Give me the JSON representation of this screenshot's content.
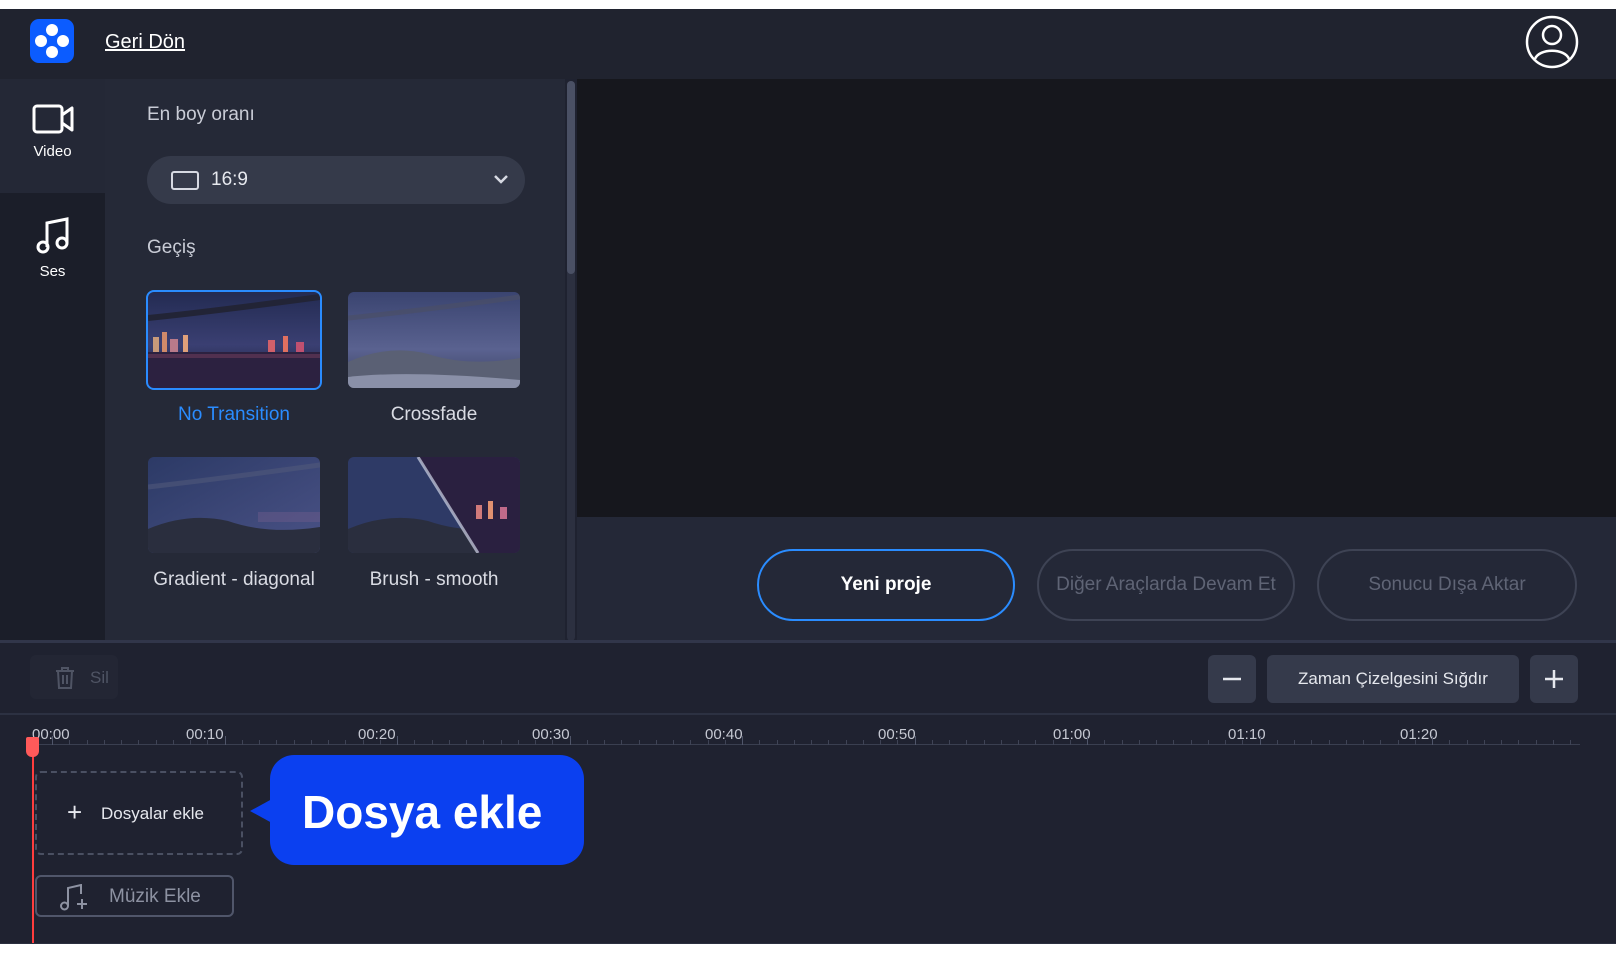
{
  "header": {
    "back_label": "Geri Dön"
  },
  "sidebar": {
    "items": [
      {
        "label": "Video",
        "icon": "video-camera-icon",
        "active": true
      },
      {
        "label": "Ses",
        "icon": "music-note-icon",
        "active": false
      }
    ]
  },
  "panel": {
    "aspect_label": "En boy oranı",
    "aspect_value": "16:9",
    "transition_label": "Geçiş",
    "transitions": [
      {
        "label": "No Transition",
        "selected": true
      },
      {
        "label": "Crossfade",
        "selected": false
      },
      {
        "label": "Gradient - diagonal",
        "selected": false
      },
      {
        "label": "Brush - smooth",
        "selected": false
      }
    ]
  },
  "actions": {
    "new_project": "Yeni proje",
    "continue_other": "Diğer Araçlarda Devam Et",
    "export": "Sonucu Dışa Aktar"
  },
  "toolbar": {
    "delete_label": "Sil",
    "fit_timeline": "Zaman Çizelgesini Sığdır",
    "zoom_out_icon": "minus-icon",
    "zoom_in_icon": "plus-icon"
  },
  "timeline": {
    "ticks": [
      "00:00",
      "00:10",
      "00:20",
      "00:30",
      "00:40",
      "00:50",
      "01:00",
      "01:10",
      "01:20"
    ],
    "add_files_label": "Dosyalar ekle",
    "add_music_label": "Müzik Ekle",
    "tooltip": "Dosya ekle",
    "playhead_color": "#ff3d3d"
  },
  "colors": {
    "accent": "#2a8cff",
    "tooltip_bg": "#0b40f0",
    "logo_bg": "#0b5cff",
    "background": "#1f2230"
  }
}
